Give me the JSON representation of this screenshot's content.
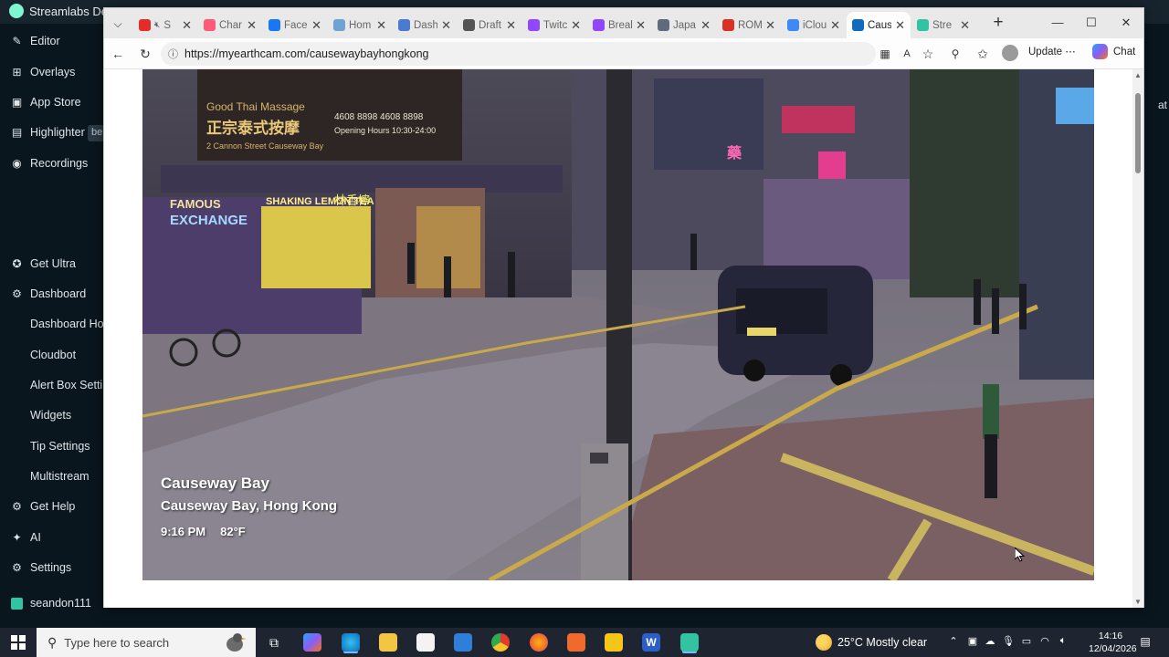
{
  "streamlabs": {
    "title": "Streamlabs De",
    "right_peek": "at",
    "badge": "be",
    "items": [
      {
        "label": "Editor",
        "icon": "edit-icon"
      },
      {
        "label": "Overlays",
        "icon": "overlays-icon"
      },
      {
        "label": "App Store",
        "icon": "store-icon"
      },
      {
        "label": "Highlighter",
        "icon": "highlighter-icon"
      },
      {
        "label": "Recordings",
        "icon": "recordings-icon"
      },
      {
        "label": "Get Ultra",
        "icon": "ultra-icon"
      },
      {
        "label": "Dashboard",
        "icon": "dashboard-icon"
      },
      {
        "label": "Dashboard Hor"
      },
      {
        "label": "Cloudbot"
      },
      {
        "label": "Alert Box Settin"
      },
      {
        "label": "Widgets"
      },
      {
        "label": "Tip Settings"
      },
      {
        "label": "Multistream"
      },
      {
        "label": "Get Help",
        "icon": "help-icon"
      },
      {
        "label": "AI",
        "icon": "ai-icon"
      },
      {
        "label": "Settings",
        "icon": "settings-icon"
      }
    ],
    "user": "seandon111"
  },
  "browser": {
    "tabs": [
      {
        "label": "S",
        "fav": "#e52d27",
        "extra": "muted-speaker"
      },
      {
        "label": "Char",
        "fav": "#ff5a79"
      },
      {
        "label": "Facel",
        "fav": "#1877f2"
      },
      {
        "label": "Hom",
        "fav": "#6fa3d6"
      },
      {
        "label": "Dash",
        "fav": "#4a7bd0"
      },
      {
        "label": "Draft",
        "fav": "#555555"
      },
      {
        "label": "Twitc",
        "fav": "#9146ff"
      },
      {
        "label": "Break",
        "fav": "#9146ff"
      },
      {
        "label": "Japa",
        "fav": "#5f6b7a"
      },
      {
        "label": "ROM",
        "fav": "#d93025"
      },
      {
        "label": "iClou",
        "fav": "#3d8af7"
      },
      {
        "label": "Caus",
        "fav": "#0f6cbd",
        "active": true
      },
      {
        "label": "Stre",
        "fav": "#31c3a2"
      }
    ],
    "url": "https://myearthcam.com/causewaybayhongkong",
    "update_label": "Update",
    "chat_label": "Chat"
  },
  "webcam": {
    "title": "Causeway Bay",
    "location": "Causeway Bay, Hong Kong",
    "time": "9:16 PM",
    "temperature": "82°F",
    "signs": {
      "massage_line1": "Good Thai Massage",
      "massage_line2": "正宗泰式按摩",
      "massage_line3": "2 Cannon Street Causeway Bay",
      "massage_phone": "4608 8898  4608 8898",
      "massage_hours": "Opening Hours 10:30-24:00",
      "exchange": "EXCHANGE",
      "famous": "FAMOUS",
      "lemon": "SHAKING LEMON TEA",
      "lemon_cn": "林香檸",
      "pharm": "藥"
    }
  },
  "taskbar": {
    "search_placeholder": "Type here to search",
    "weather": "25°C  Mostly clear",
    "time": "14:16",
    "date": "12/04/2026"
  }
}
